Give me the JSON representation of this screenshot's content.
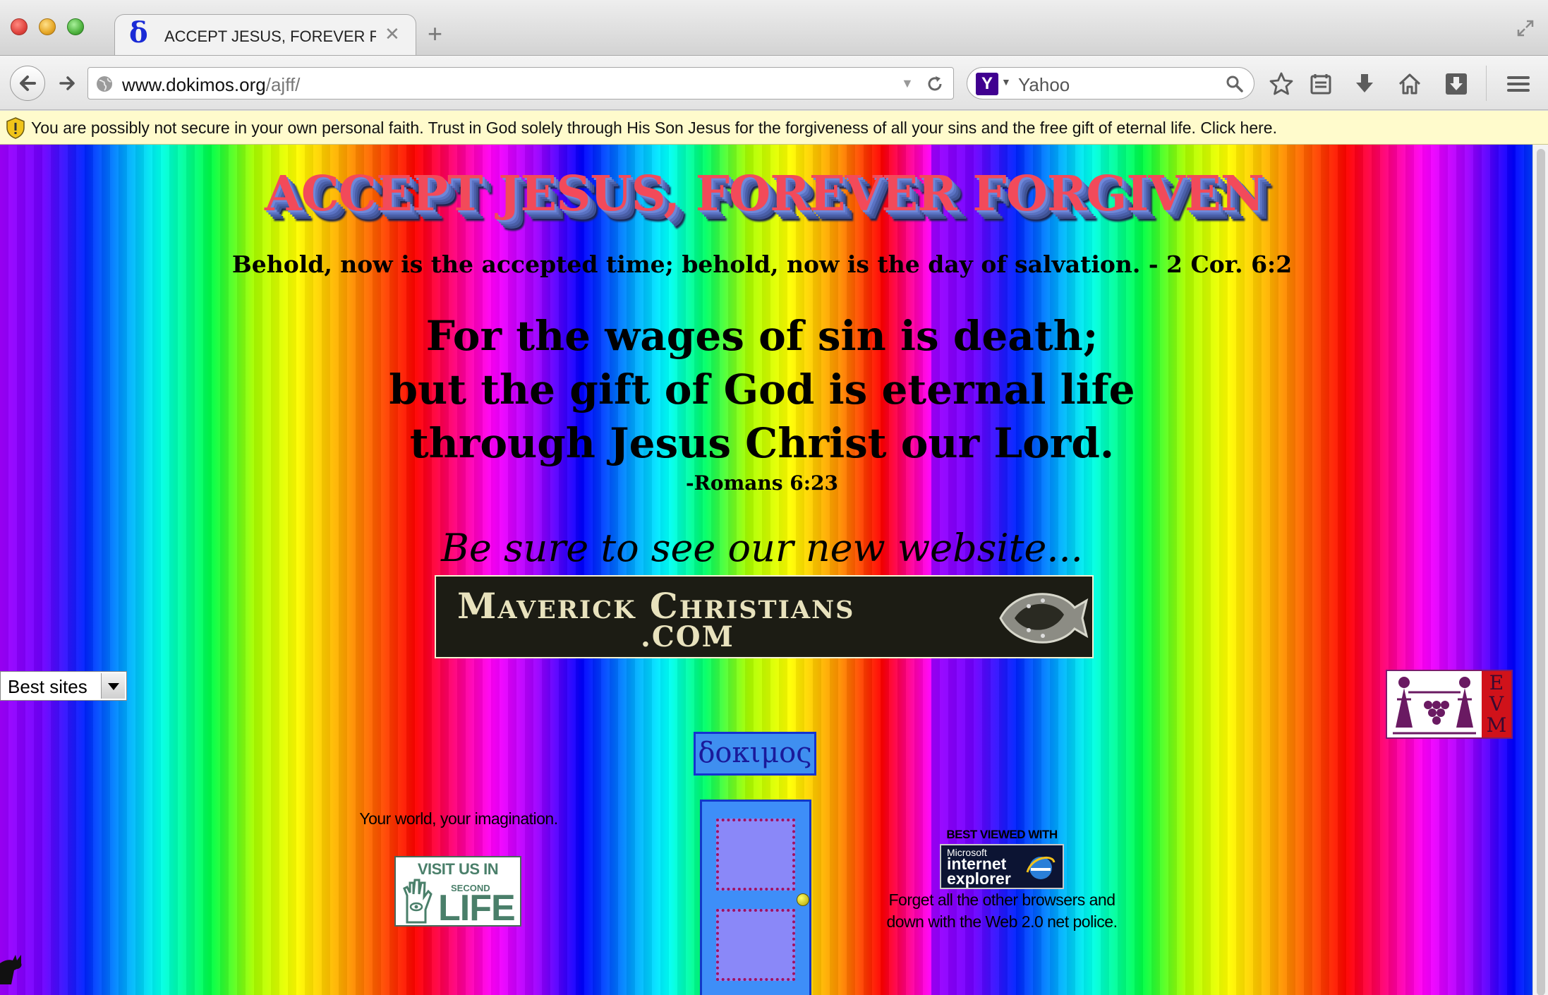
{
  "browser": {
    "tab": {
      "favicon": "δ",
      "title": "ACCEPT JESUS, FOREVER F..."
    },
    "url": {
      "host": "www.dokimos.org",
      "path": "/ajff/"
    },
    "search": {
      "engine_logo": "Y",
      "placeholder": "Yahoo"
    },
    "infobar": "You are possibly not secure in your own personal faith. Trust in God solely through His Son Jesus for the forgiveness of all your sins and the free gift of eternal life. Click here."
  },
  "page": {
    "headline": "ACCEPT JESUS, FOREVER FORGIVEN",
    "subverse": "Behold, now is the accepted time; behold, now is the day of salvation. - 2 Cor. 6:2",
    "main_verse": [
      "For the wages of sin is death;",
      "but the gift of God is eternal life",
      "through Jesus Christ our Lord."
    ],
    "verse_ref": "-Romans 6:23",
    "promo": "Be sure to see our new website...",
    "maverick_banner": {
      "line1": "Maverick Christians",
      "line2": ".COM"
    },
    "dropdown": {
      "selected": "Best sites"
    },
    "evm_letters": [
      "E",
      "V",
      "M"
    ],
    "dokimos_label": "δοκιμος",
    "left_caption": "Your world, your imagination.",
    "second_life": {
      "visit": "VISIT US IN",
      "second": "SECOND",
      "life": "LIFE"
    },
    "best_viewed": "BEST VIEWED WITH",
    "ie_badge": {
      "company": "Microsoft",
      "line1": "internet",
      "line2": "explorer"
    },
    "right_caption": [
      "Forget all the other browsers and",
      "down with the Web 2.0 net police."
    ]
  },
  "colors": {
    "headline": "#f24a5a",
    "infobar_bg": "#fffbcc",
    "door": "#3e8ef8",
    "dokimos_bg": "#3f8ff0"
  },
  "icons": [
    "back-arrow-icon",
    "forward-arrow-icon",
    "globe-icon",
    "reload-icon",
    "search-icon",
    "bookmark-star-icon",
    "reading-list-icon",
    "download-icon",
    "home-icon",
    "pocket-icon",
    "hamburger-menu-icon",
    "warning-shield-icon",
    "fullscreen-icon"
  ]
}
